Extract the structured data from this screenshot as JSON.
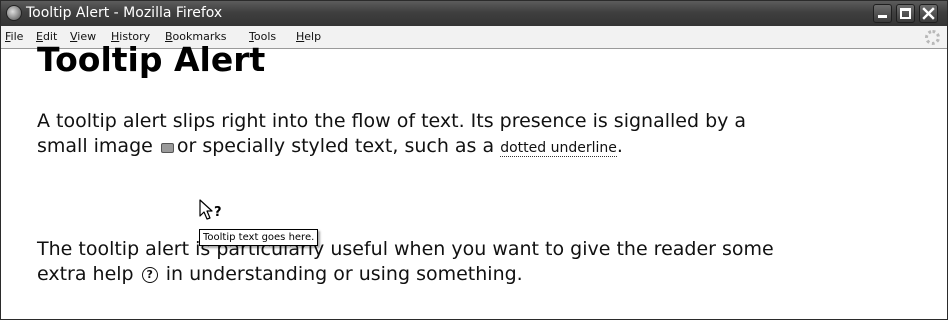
{
  "window": {
    "title": "Tooltip Alert - Mozilla Firefox",
    "buttons": [
      "minimize",
      "maximize",
      "close"
    ]
  },
  "menubar": {
    "items": [
      {
        "label": "File"
      },
      {
        "label": "Edit"
      },
      {
        "label": "View"
      },
      {
        "label": "History"
      },
      {
        "label": "Bookmarks"
      },
      {
        "label": "Tools"
      },
      {
        "label": "Help"
      }
    ]
  },
  "page": {
    "title": "Tooltip Alert",
    "para1": {
      "line1": "A tooltip alert slips right into the flow of text. Its presence is signalled by a",
      "line2_before": "small image",
      "line2_middle": "or specially styled text, such as a",
      "line2_link": "dotted underline",
      "line2_after": "."
    },
    "para2": {
      "line1": "The tooltip alert is particularly useful when you want to give the reader some",
      "line2_before": "extra help",
      "line2_icon": "?",
      "line2_after": "in understanding or using something."
    },
    "tooltip": "Tooltip text goes here."
  },
  "icons": {
    "app": "firefox-icon",
    "throbber": "throbber-icon",
    "inline_image": "flag-icon",
    "help": "question-circle-icon",
    "cursor": "help-cursor-icon"
  }
}
